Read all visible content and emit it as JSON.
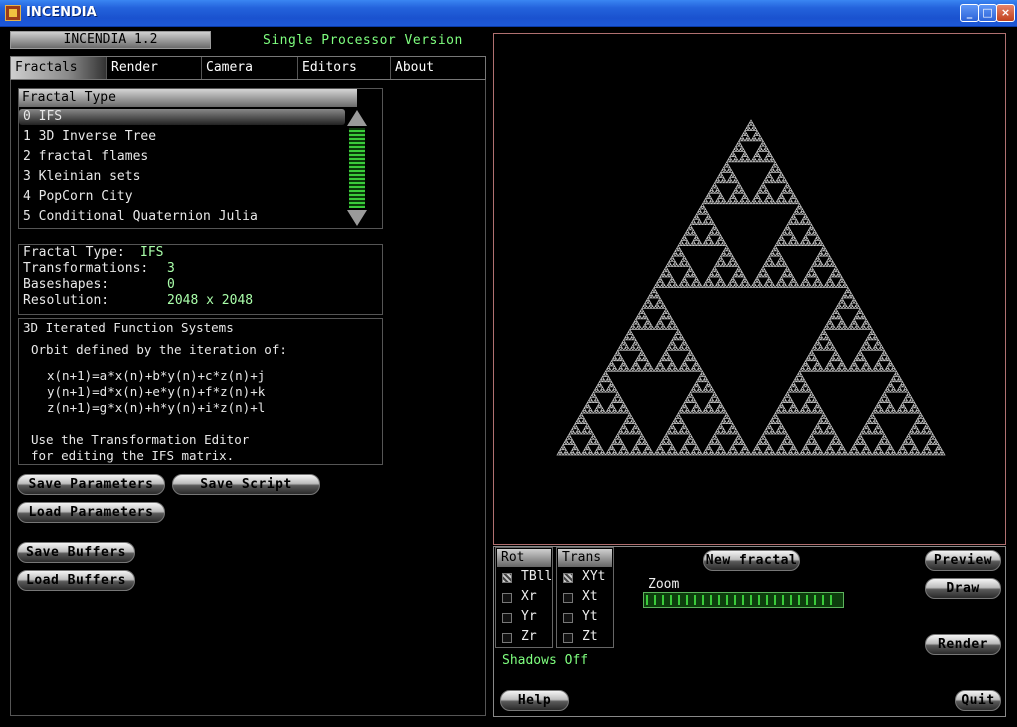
{
  "window": {
    "title": "INCENDIA"
  },
  "app": {
    "version": "INCENDIA 1.2",
    "processor_mode": "Single Processor Version"
  },
  "tabs": [
    {
      "label": "Fractals",
      "active": true
    },
    {
      "label": "Render",
      "active": false
    },
    {
      "label": "Camera",
      "active": false
    },
    {
      "label": "Editors",
      "active": false
    },
    {
      "label": "About",
      "active": false
    }
  ],
  "fractal_types": {
    "header": "Fractal Type",
    "items": [
      "0 IFS",
      "1 3D Inverse Tree",
      "2 fractal flames",
      "3 Kleinian sets",
      "4 PopCorn City",
      "5 Conditional Quaternion Julia"
    ],
    "selected_index": 0
  },
  "info": {
    "fractal_type_label": "Fractal Type:",
    "fractal_type_value": "IFS",
    "transformations_label": "Transformations:",
    "transformations_value": "3",
    "baseshapes_label": "Baseshapes:",
    "baseshapes_value": "0",
    "resolution_label": "Resolution:",
    "resolution_value": "2048 x 2048"
  },
  "description": {
    "title": "3D Iterated Function Systems",
    "intro": "Orbit defined by the iteration of:",
    "eq1": "x(n+1)=a*x(n)+b*y(n)+c*z(n)+j",
    "eq2": "y(n+1)=d*x(n)+e*y(n)+f*z(n)+k",
    "eq3": "z(n+1)=g*x(n)+h*y(n)+i*z(n)+l",
    "note1": "Use the Transformation Editor",
    "note2": "for editing the IFS matrix."
  },
  "buttons": {
    "save_parameters": "Save Parameters",
    "save_script": "Save Script",
    "load_parameters": "Load Parameters",
    "save_buffers": "Save Buffers",
    "load_buffers": "Load Buffers",
    "new_fractal": "New fractal",
    "preview": "Preview",
    "draw": "Draw",
    "render": "Render",
    "help": "Help",
    "quit": "Quit"
  },
  "rot": {
    "header": "Rot",
    "options": [
      {
        "label": "TBll",
        "checked": true
      },
      {
        "label": "Xr",
        "checked": false
      },
      {
        "label": "Yr",
        "checked": false
      },
      {
        "label": "Zr",
        "checked": false
      }
    ]
  },
  "trans": {
    "header": "Trans",
    "options": [
      {
        "label": "XYt",
        "checked": true
      },
      {
        "label": "Xt",
        "checked": false
      },
      {
        "label": "Yt",
        "checked": false
      },
      {
        "label": "Zt",
        "checked": false
      }
    ]
  },
  "shadows": "Shadows Off",
  "zoom": {
    "label": "Zoom",
    "level": 0.97
  },
  "colors": {
    "accent_green": "#7fff7f",
    "fractal_color": "#c8c8c8",
    "viewport_border": "#b07070"
  }
}
